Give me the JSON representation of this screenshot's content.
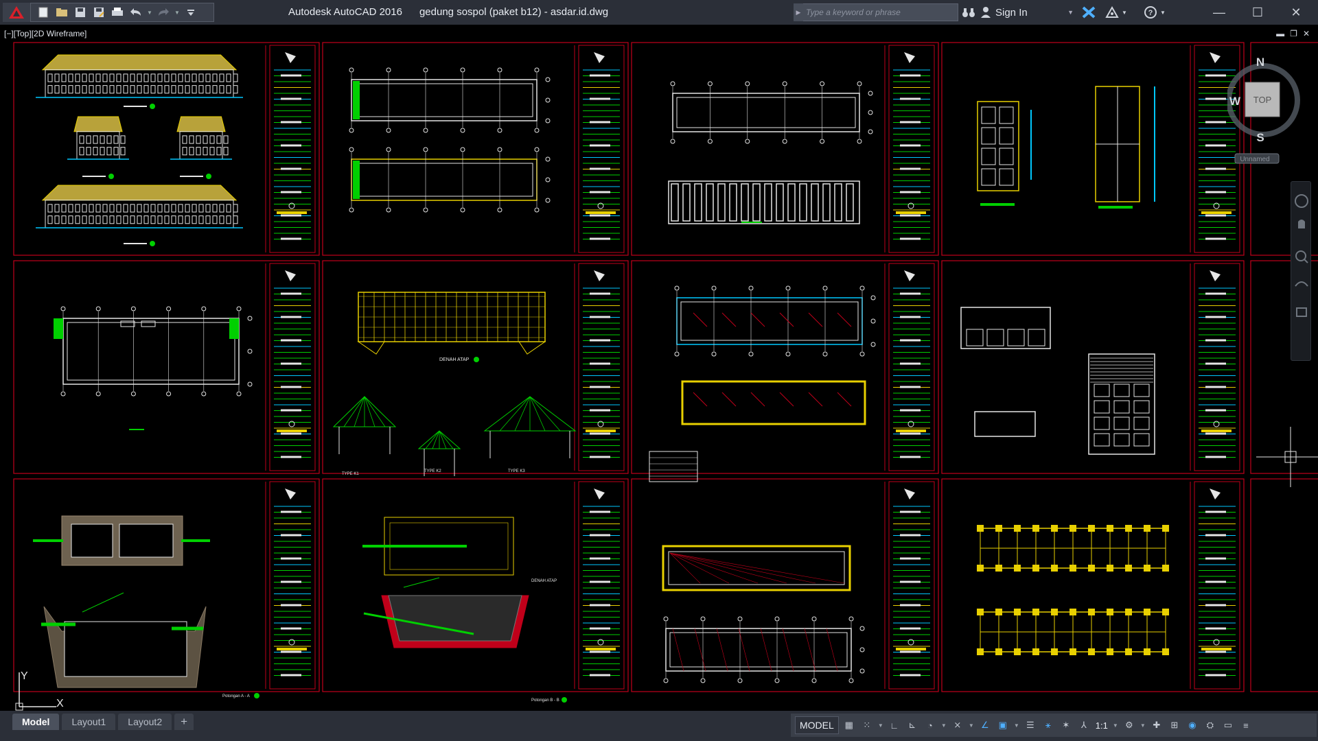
{
  "titlebar": {
    "app_name": "Autodesk AutoCAD 2016",
    "file_name": "gedung sospol (paket b12) - asdar.id.dwg",
    "search_placeholder": "Type a keyword or phrase",
    "sign_in_label": "Sign In"
  },
  "quick_access": {
    "icons": [
      "new-icon",
      "open-icon",
      "save-icon",
      "save-as-icon",
      "plot-icon",
      "undo-icon",
      "redo-icon"
    ]
  },
  "viewport": {
    "label": "[−][Top][2D Wireframe]",
    "controls": [
      "▬",
      "❐",
      "✕"
    ],
    "viewcube": {
      "north": "N",
      "west": "W",
      "south": "S",
      "face": "TOP",
      "named_view": "Unnamed"
    },
    "ucs": {
      "y": "Y",
      "x": "X"
    },
    "sheet_labels": {
      "denah_atap": "DENAH ATAP",
      "type_k1": "TYPE K1",
      "type_k2": "TYPE K2",
      "type_k3": "TYPE K3",
      "potongan_aa": "Potongan A - A",
      "potongan_bb": "Potongan B - B"
    }
  },
  "layout_tabs": [
    {
      "label": "Model",
      "active": true
    },
    {
      "label": "Layout1",
      "active": false
    },
    {
      "label": "Layout2",
      "active": false
    }
  ],
  "add_tab_label": "+",
  "statusbar": {
    "model_label": "MODEL",
    "scale_label": "1:1"
  },
  "colors": {
    "frame": "#c0001a",
    "green": "#00d000",
    "yellow": "#e8d000",
    "cyan": "#00c8ff",
    "white": "#e6e6e6",
    "accent": "#4fb0ff"
  }
}
